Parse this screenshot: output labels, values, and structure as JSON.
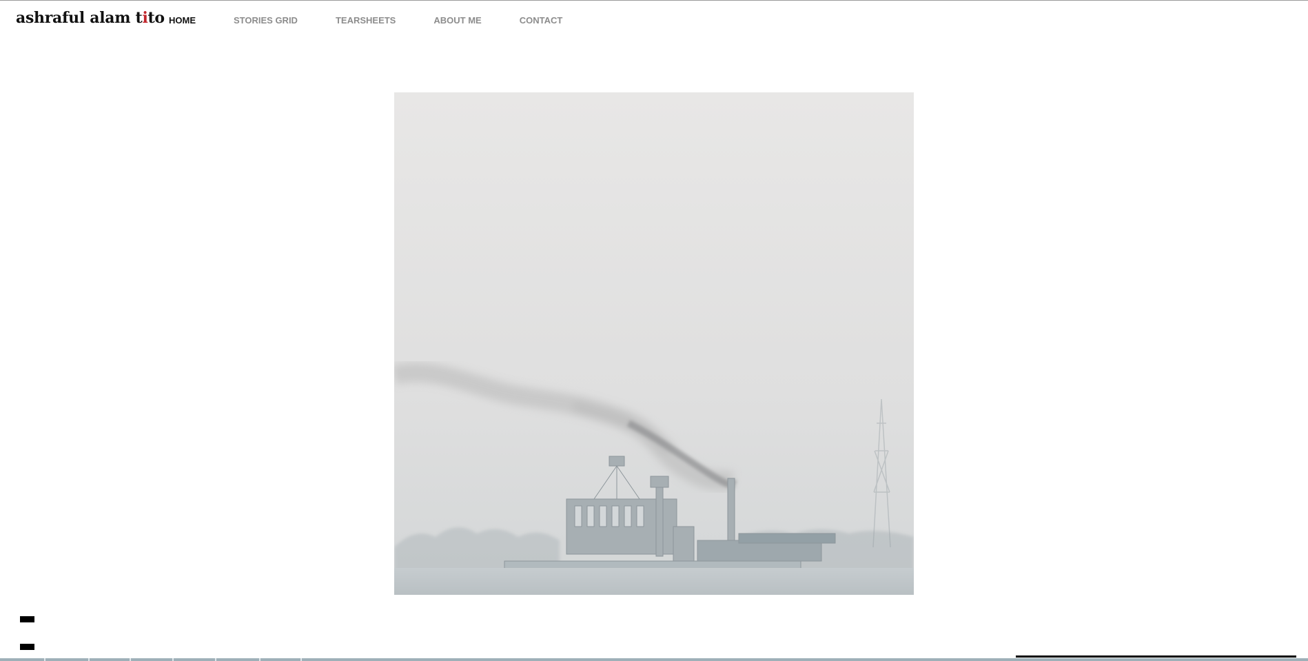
{
  "site": {
    "logo_text_part1": "ashraful alam t",
    "logo_text_accent": "i",
    "logo_text_part2": "to",
    "accent_color": "#c1272d"
  },
  "nav": {
    "items": [
      {
        "label": "HOME",
        "active": true
      },
      {
        "label": "STORIES GRID",
        "active": false
      },
      {
        "label": "TEARSHEETS",
        "active": false
      },
      {
        "label": "ABOUT ME",
        "active": false
      },
      {
        "label": "CONTACT",
        "active": false
      }
    ]
  },
  "hero": {
    "image": "hazy-industrial-factory-photo"
  },
  "controls": {
    "icons": [
      "slide-control-icon",
      "slide-control-icon"
    ]
  }
}
